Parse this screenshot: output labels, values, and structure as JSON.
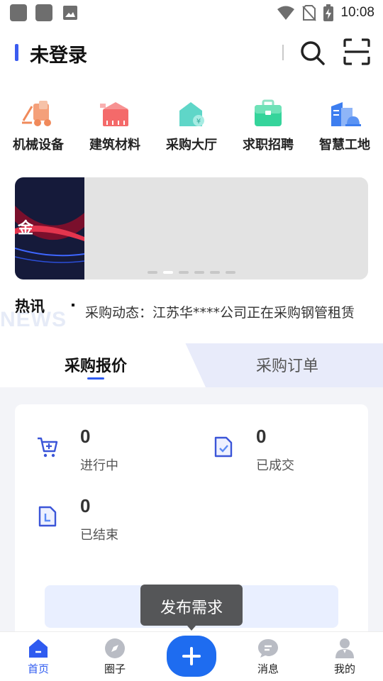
{
  "status_bar": {
    "time": "10:08",
    "icons": [
      "notification-square-icon",
      "notification-square-icon",
      "image-icon",
      "wifi-icon",
      "no-sim-icon",
      "battery-charging-icon"
    ]
  },
  "header": {
    "title": "未登录",
    "icons": [
      "search-icon",
      "scan-icon"
    ]
  },
  "categories": [
    {
      "label": "机械设备",
      "icon": "forklift-icon"
    },
    {
      "label": "建筑材料",
      "icon": "building-materials-icon"
    },
    {
      "label": "采购大厅",
      "icon": "procurement-hall-icon"
    },
    {
      "label": "求职招聘",
      "icon": "briefcase-icon"
    },
    {
      "label": "智慧工地",
      "icon": "smart-site-icon"
    }
  ],
  "banner": {
    "text": "金",
    "slide_count": 6,
    "active_slide": 2
  },
  "news": {
    "title": "热讯",
    "watermark": "NEWS",
    "text": "采购动态：江苏华****公司正在采购钢管租赁"
  },
  "tabs": [
    {
      "label": "采购报价",
      "active": true
    },
    {
      "label": "采购订单",
      "active": false
    }
  ],
  "stats": [
    {
      "value": "0",
      "label": "进行中",
      "icon": "cart-add-icon"
    },
    {
      "value": "0",
      "label": "已成交",
      "icon": "document-check-icon"
    },
    {
      "value": "0",
      "label": "已结束",
      "icon": "document-corner-icon"
    }
  ],
  "tooltip": {
    "text": "发布需求"
  },
  "bottom_nav": [
    {
      "label": "首页",
      "icon": "home-icon",
      "active": true
    },
    {
      "label": "圈子",
      "icon": "compass-icon",
      "active": false
    },
    {
      "label": "",
      "icon": "plus-icon",
      "active": false
    },
    {
      "label": "消息",
      "icon": "message-icon",
      "active": false
    },
    {
      "label": "我的",
      "icon": "user-icon",
      "active": false
    }
  ],
  "colors": {
    "accent": "#2f5bf0",
    "fab": "#1e6cf0",
    "tab_inactive_bg": "#e8ebfa",
    "content_bg": "#f3f4f8"
  }
}
